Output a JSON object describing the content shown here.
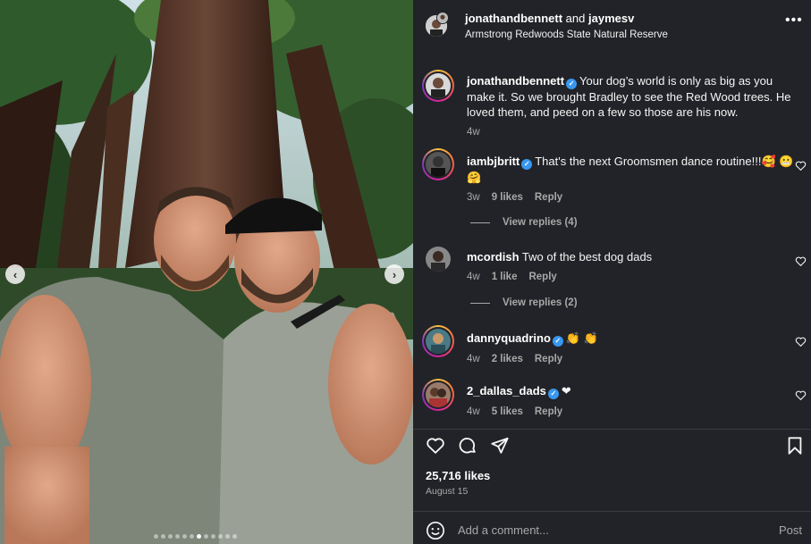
{
  "post": {
    "authors": {
      "primary": "jonathandbennett",
      "joiner": "and",
      "secondary": "jaymesv"
    },
    "location": "Armstrong Redwoods State Natural Reserve",
    "more_icon": "more-horizontal-icon",
    "caption": {
      "user": "jonathandbennett",
      "text": "Your dog’s world is only as big as you make it. So we brought Bradley to see the Red Wood trees. He loved them, and peed on a few so those are his now.",
      "age": "4w"
    },
    "photo": {
      "carousel_count": 12,
      "active_index": 6,
      "prev_icon": "chevron-left-icon",
      "next_icon": "chevron-right-icon"
    }
  },
  "comments": [
    {
      "user": "iambjbritt",
      "verified": true,
      "text": "That's the next Groomsmen dance routine!!!🥰 😬 🤗",
      "age": "3w",
      "likes": "9 likes",
      "reply": "Reply",
      "view_replies": "View replies (4)"
    },
    {
      "user": "mcordish",
      "verified": false,
      "text": "Two of the best dog dads",
      "age": "4w",
      "likes": "1 like",
      "reply": "Reply",
      "view_replies": "View replies (2)"
    },
    {
      "user": "dannyquadrino",
      "verified": true,
      "text": "👏 👏",
      "age": "4w",
      "likes": "2 likes",
      "reply": "Reply"
    },
    {
      "user": "2_dallas_dads",
      "verified": true,
      "text": "❤",
      "age": "4w",
      "likes": "5 likes",
      "reply": "Reply"
    }
  ],
  "footer": {
    "likes": "25,716 likes",
    "date": "August 15",
    "comment_placeholder": "Add a comment...",
    "post_label": "Post",
    "icons": [
      "heart-icon",
      "comment-icon",
      "share-icon",
      "bookmark-icon",
      "emoji-icon"
    ]
  },
  "colors": {
    "panel_bg": "#212328",
    "verified": "#3897f0",
    "muted_text": "#a8a8a8"
  }
}
